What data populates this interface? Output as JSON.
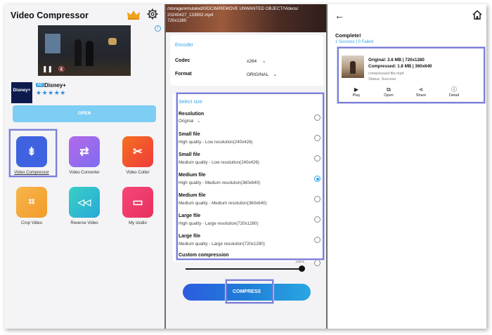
{
  "home": {
    "app_title": "Video Compressor",
    "ad": {
      "brand_logo_text": "Disney+",
      "tag": "AD",
      "name": "Disney+",
      "stars": "★★★★★",
      "play_glyph": "❚❚",
      "mute_glyph": "🔇",
      "info_glyph": "i"
    },
    "open_label": "OPEN",
    "tools": [
      {
        "label": "Video Compressor",
        "glyph": "⇟"
      },
      {
        "label": "Video Converter",
        "glyph": "⇄"
      },
      {
        "label": "Video Cutter",
        "glyph": "✂"
      },
      {
        "label": "Crop Video",
        "glyph": "⌗"
      },
      {
        "label": "Reverse Video",
        "glyph": "◁◁"
      },
      {
        "label": "My studio",
        "glyph": "▭"
      }
    ],
    "colors": {
      "compressor": "#3f63e0",
      "converter": "#a86ee6",
      "cutter": "#f25a2a",
      "crop": "#f6a63a",
      "reverse": "#2ec2c9",
      "studio": "#ef3b6c"
    }
  },
  "settings": {
    "path_line1": "/storage/emulated/0/DCIM/REMOVE UNWANTED OBJECT/Videos/",
    "path_line2": "20240427_133902.mp4",
    "path_line3": "720x1280",
    "encoder_label": "Encoder",
    "codec_label": "Codec",
    "codec_value": "x264",
    "format_label": "Format",
    "format_value": "ORIGINAL",
    "dropdown_glyph": "⌄",
    "select_size_label": "Select size",
    "resolution_label": "Resolution",
    "resolution_value": "Original",
    "options": [
      {
        "title": "Small file",
        "sub": "High quality - Low resolution(240x426)",
        "selected": false
      },
      {
        "title": "Small file",
        "sub": "Medium quality - Low resolution(240x426)",
        "selected": false
      },
      {
        "title": "Medium file",
        "sub": "High quality - Medium resolution(360x640)",
        "selected": true
      },
      {
        "title": "Medium file",
        "sub": "Medium quality - Medium resolution(360x640)",
        "selected": false
      },
      {
        "title": "Large file",
        "sub": "High quality - Large resolution(720x1280)",
        "selected": false
      },
      {
        "title": "Large file",
        "sub": "Medium quality - Large resolution(720x1280)",
        "selected": false
      }
    ],
    "custom_label": "Custom compression",
    "slider_pct": "100%",
    "compress_label": "COMPRESS"
  },
  "result": {
    "back_glyph": "←",
    "complete_title": "Complete!",
    "summary": "1 Success | 0 Failed",
    "original": "Original: 3.6 MB | 720x1280",
    "compressed": "Compressed: 1.8 MB | 360x640",
    "file_name": "compressed file.mp4",
    "status": "Status: Success",
    "actions": [
      {
        "label": "Play",
        "glyph": "▶"
      },
      {
        "label": "Open",
        "glyph": "⧉"
      },
      {
        "label": "Share",
        "glyph": "⋖"
      },
      {
        "label": "Detail",
        "glyph": "ⓘ"
      }
    ]
  },
  "highlight_color": "#7b7fd6"
}
